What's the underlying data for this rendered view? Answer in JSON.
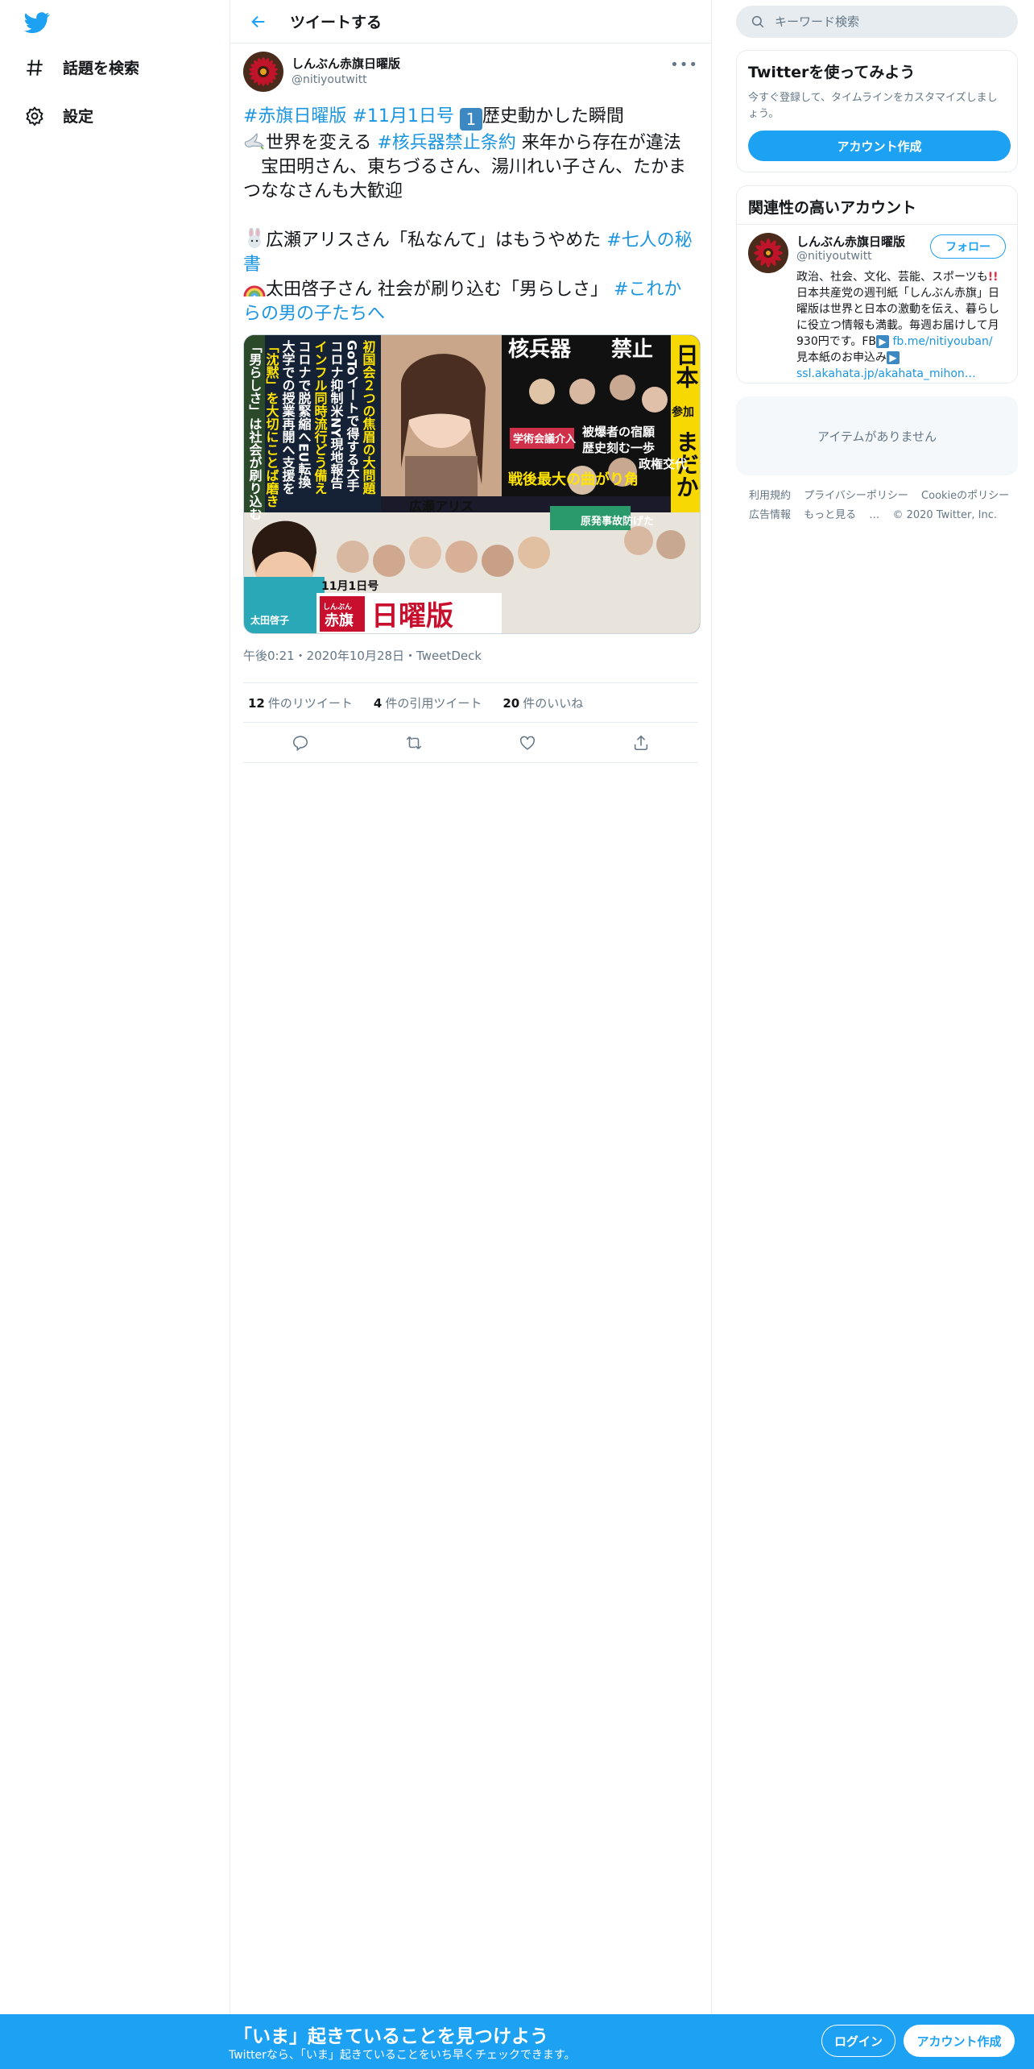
{
  "nav": {
    "explore_label": "話題を検索",
    "settings_label": "設定"
  },
  "header": {
    "title": "ツイートする"
  },
  "tweet": {
    "display_name": "しんぶん赤旗日曜版",
    "username": "@nitiyoutwitt",
    "line1": {
      "tag1": "#赤旗日曜版",
      "tag2": "#11月1日号",
      "num": "1",
      "text": "歴史動かした瞬間"
    },
    "line2": {
      "prefix": "世界を変える ",
      "tag": "#核兵器禁止条約",
      "suffix": " 来年から存在が違法"
    },
    "line3": "　宝田明さん、東ちづるさん、湯川れい子さん、たかまつななさんも大歓迎",
    "line4": {
      "prefix": "広瀬アリスさん「私なんて」はもうやめた ",
      "tag": "#七人の秘書"
    },
    "line5": {
      "prefix": "太田啓子さん 社会が刷り込む「男らしさ」 ",
      "tag": "#これからの男の子たちへ"
    },
    "image_text": {
      "headline1": "核兵器",
      "headline1b": "禁止",
      "headline2": "日本",
      "headline2b": "参加",
      "headline2c": "まだか",
      "sub1": "被爆者の宿願",
      "sub2": "歴史刻む一歩",
      "sub3": "戦後最大の曲がり角",
      "sub4": "政権交代",
      "col1": "初国会２つの焦眉の大問題",
      "col2": "GoToイートで得する大手",
      "col3": "コロナ抑制米NY現地報告",
      "col4": "インフル同時流行どう備え",
      "col5": "コロナで脱緊縮へEU転換",
      "col6": "大学での授業再開へ支援を",
      "col7": "「沈黙」を大切にことば磨き",
      "col8": "「男らしさ」は社会が刷り込む",
      "person1": "広瀬アリス",
      "person2": "太田啓子",
      "mast_small": "しんぶん",
      "mast": "赤旗",
      "mast_title": "日曜版",
      "issue": "11月1日号",
      "nuclear": "原発事故防げた",
      "science": "学術会議介入"
    },
    "timestamp": "午後0:21・2020年10月28日・TweetDeck",
    "retweets": "12",
    "retweets_label": "件のリツイート",
    "quotes": "4",
    "quotes_label": "件の引用ツイート",
    "likes": "20",
    "likes_label": "件のいいね"
  },
  "search": {
    "placeholder": "キーワード検索"
  },
  "signup_card": {
    "title": "Twitterを使ってみよう",
    "text": "今すぐ登録して、タイムラインをカスタマイズしましょう。",
    "button": "アカウント作成"
  },
  "related": {
    "title": "関連性の高いアカウント",
    "display_name": "しんぶん赤旗日曜版",
    "username": "@nitiyoutwitt",
    "follow": "フォロー",
    "bio1": "政治、社会、文化、芸能、スポーツも",
    "bio2": "日本共産党の週刊紙「しんぶん赤旗」日曜版は世界と日本の激動を伝え、暮らしに役立つ情報も満載。毎週お届けして月930円です。FB",
    "link1": "fb.me/nitiyouban/",
    "bio3": " 見本紙のお申込み",
    "link2": "ssl.akahata.jp/akahata_mihon…"
  },
  "trends": {
    "empty": "アイテムがありません"
  },
  "footer": {
    "terms": "利用規約",
    "privacy": "プライバシーポリシー",
    "cookie": "Cookieのポリシー",
    "ads": "広告情報",
    "more": "もっと見る",
    "copyright": "© 2020 Twitter, Inc."
  },
  "bottom_bar": {
    "title": "「いま」起きていることを見つけよう",
    "subtitle": "Twitterなら、「いま」起きていることをいち早くチェックできます。",
    "login": "ログイン",
    "signup": "アカウント作成"
  },
  "colors": {
    "accent": "#1da1f2",
    "link": "#1b95e0",
    "muted": "#657786"
  }
}
